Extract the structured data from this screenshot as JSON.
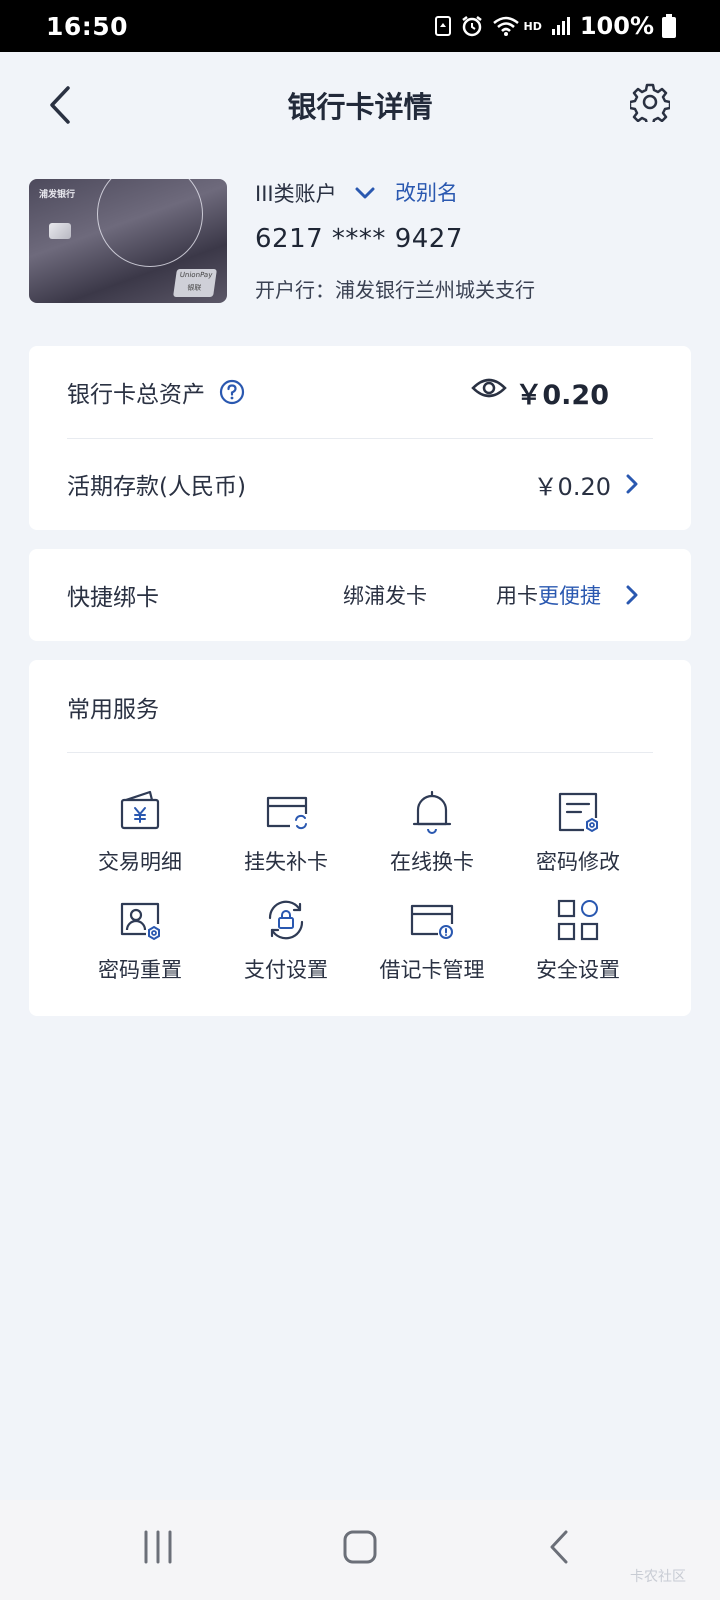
{
  "status": {
    "time": "16:50",
    "battery": "100%",
    "network": "HD"
  },
  "header": {
    "title": "银行卡详情"
  },
  "card": {
    "bank_logo_text": "浦发银行",
    "account_type": "III类账户",
    "rename_label": "改别名",
    "number": "6217 **** 9427",
    "open_bank": "开户行：浦发银行兰州城关支行"
  },
  "assets": {
    "total_label": "银行卡总资产",
    "total_amount": "￥0.20",
    "demand_label": "活期存款(人民币)",
    "demand_amount": "￥0.20"
  },
  "quickbind": {
    "label": "快捷绑卡",
    "promo1": "绑浦发卡",
    "promo2_prefix": "用卡",
    "promo2_highlight": "更便捷"
  },
  "services": {
    "title": "常用服务",
    "items": [
      {
        "label": "交易明细",
        "icon": "transaction-wallet-icon"
      },
      {
        "label": "挂失补卡",
        "icon": "card-reissue-icon"
      },
      {
        "label": "在线换卡",
        "icon": "bell-icon"
      },
      {
        "label": "密码修改",
        "icon": "password-edit-icon"
      },
      {
        "label": "密码重置",
        "icon": "password-reset-icon"
      },
      {
        "label": "支付设置",
        "icon": "payment-lock-icon"
      },
      {
        "label": "借记卡管理",
        "icon": "debit-card-manage-icon"
      },
      {
        "label": "安全设置",
        "icon": "security-grid-icon"
      }
    ]
  },
  "colors": {
    "accent": "#2a58b0",
    "background": "#f1f4f9",
    "icon_stroke": "#2f3b55"
  },
  "watermark": "卡农社区"
}
